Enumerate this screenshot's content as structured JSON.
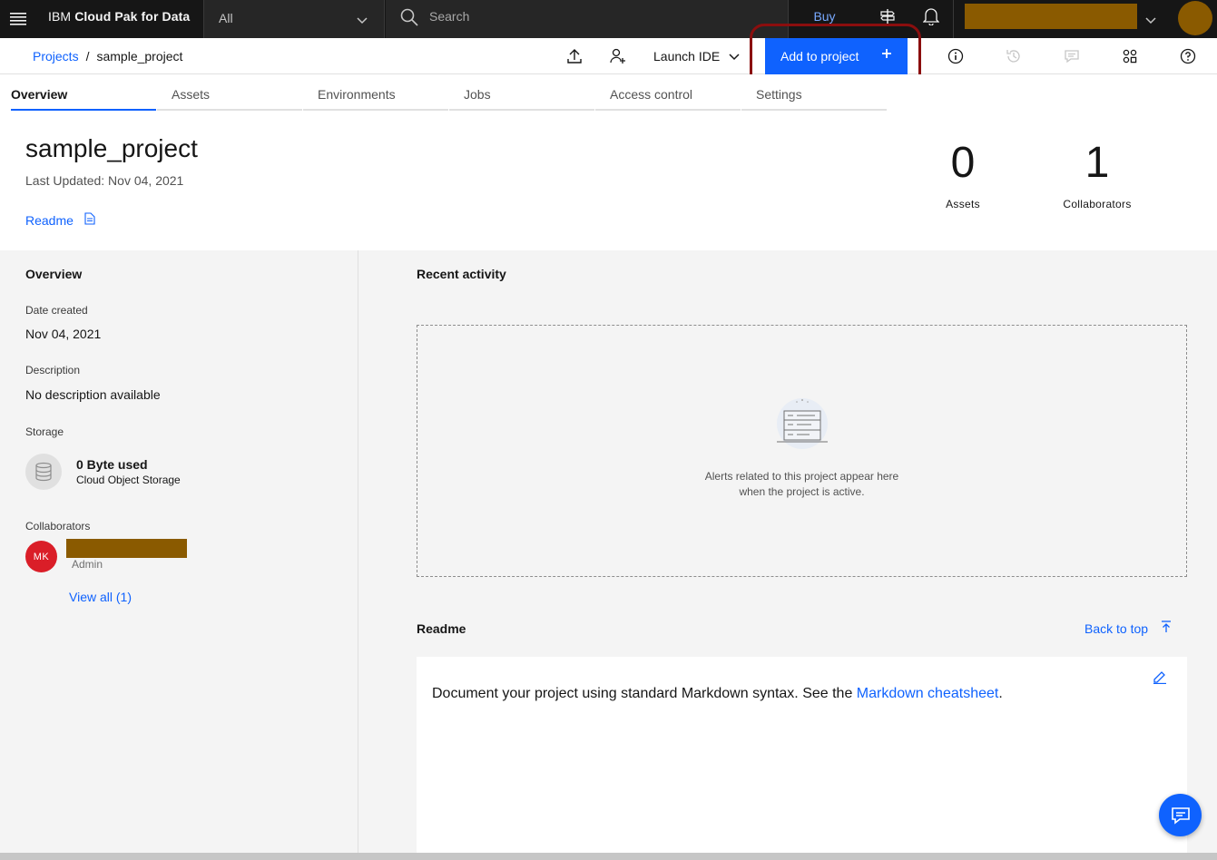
{
  "topbar": {
    "brand_prefix": "IBM",
    "brand_name": "Cloud Pak for Data",
    "scope_value": "All",
    "search_placeholder": "Search",
    "buy_label": "Buy"
  },
  "subheader": {
    "breadcrumb_root": "Projects",
    "breadcrumb_separator": "/",
    "breadcrumb_current": "sample_project",
    "launch_ide_label": "Launch IDE",
    "add_to_project_label": "Add to project",
    "add_icon": "+"
  },
  "tabs": [
    "Overview",
    "Assets",
    "Environments",
    "Jobs",
    "Access control",
    "Settings"
  ],
  "project": {
    "title": "sample_project",
    "last_updated": "Last Updated: Nov 04, 2021",
    "readme_link": "Readme",
    "stats": [
      {
        "value": "0",
        "label": "Assets"
      },
      {
        "value": "1",
        "label": "Collaborators"
      }
    ]
  },
  "overview_panel": {
    "title": "Overview",
    "date_created_label": "Date created",
    "date_created_value": "Nov 04, 2021",
    "description_label": "Description",
    "description_value": "No description available",
    "storage_label": "Storage",
    "storage_used": "0 Byte used",
    "storage_type": "Cloud Object Storage",
    "collaborators_label": "Collaborators",
    "collaborator_initials": "MK",
    "collaborator_role": "Admin",
    "view_all_label": "View all (1)"
  },
  "recent_activity": {
    "title": "Recent activity",
    "empty_line1": "Alerts related to this project appear here",
    "empty_line2": "when the project is active."
  },
  "readme": {
    "title": "Readme",
    "back_to_top": "Back to top",
    "body_prefix": "Document your project using standard Markdown syntax. See the ",
    "body_link": "Markdown cheatsheet",
    "body_suffix": "."
  },
  "colors": {
    "accent": "#0f62fe",
    "topbar": "#161616",
    "highlight_ring": "#8b0e0e",
    "redaction": "#8a5a00",
    "avatar_bg": "#da1e28"
  }
}
